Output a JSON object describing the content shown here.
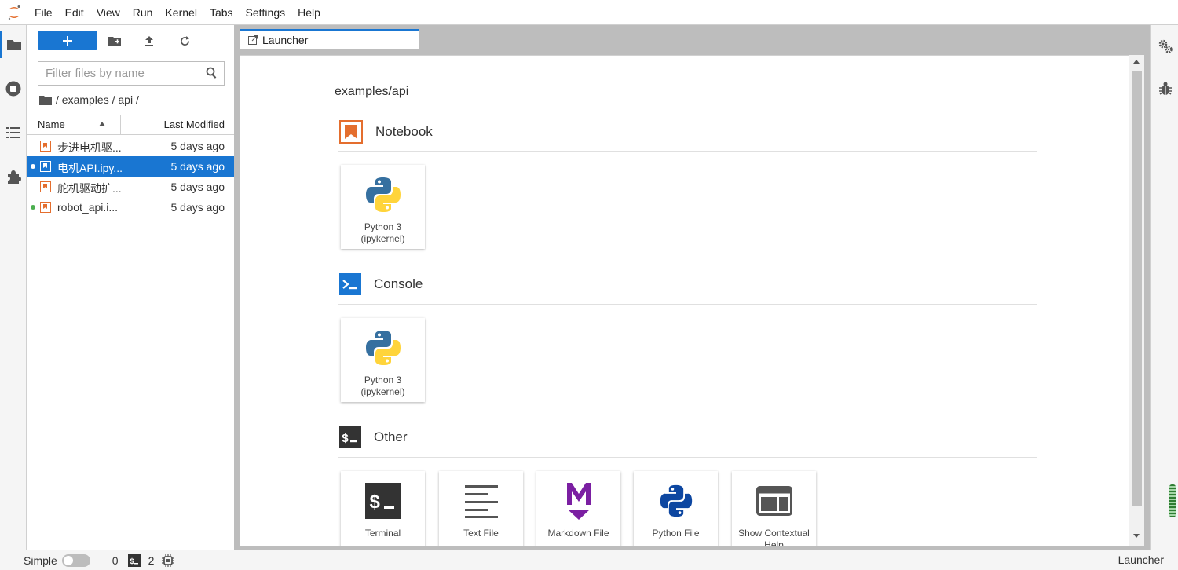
{
  "menubar": {
    "items": [
      "File",
      "Edit",
      "View",
      "Run",
      "Kernel",
      "Tabs",
      "Settings",
      "Help"
    ]
  },
  "filebrowser": {
    "filter_placeholder": "Filter files by name",
    "breadcrumb": "/ examples / api /",
    "columns": {
      "name": "Name",
      "modified": "Last Modified"
    },
    "files": [
      {
        "name": "步进电机驱...",
        "modified": "5 days ago",
        "selected": false,
        "running": false
      },
      {
        "name": "电机API.ipy...",
        "modified": "5 days ago",
        "selected": true,
        "running": true
      },
      {
        "name": "舵机驱动扩...",
        "modified": "5 days ago",
        "selected": false,
        "running": false
      },
      {
        "name": "robot_api.i...",
        "modified": "5 days ago",
        "selected": false,
        "running": true
      }
    ]
  },
  "tabs": {
    "launcher": "Launcher"
  },
  "launcher": {
    "cwd": "examples/api",
    "sections": {
      "notebook": {
        "title": "Notebook",
        "cards": [
          {
            "line1": "Python 3",
            "line2": "(ipykernel)"
          }
        ]
      },
      "console": {
        "title": "Console",
        "cards": [
          {
            "line1": "Python 3",
            "line2": "(ipykernel)"
          }
        ]
      },
      "other": {
        "title": "Other",
        "cards": [
          {
            "label": "Terminal"
          },
          {
            "label": "Text File"
          },
          {
            "label": "Markdown File"
          },
          {
            "label": "Python File"
          },
          {
            "label": "Show Contextual Help"
          }
        ]
      }
    }
  },
  "statusbar": {
    "simple_label": "Simple",
    "kernels_count": "0",
    "terminals_count": "2",
    "right_label": "Launcher"
  },
  "colors": {
    "accent": "#1976d2",
    "notebook_orange": "#e46e2e",
    "markdown_purple": "#7b1fa2",
    "python_blue": "#3670a0",
    "python_yellow": "#ffd43b"
  }
}
